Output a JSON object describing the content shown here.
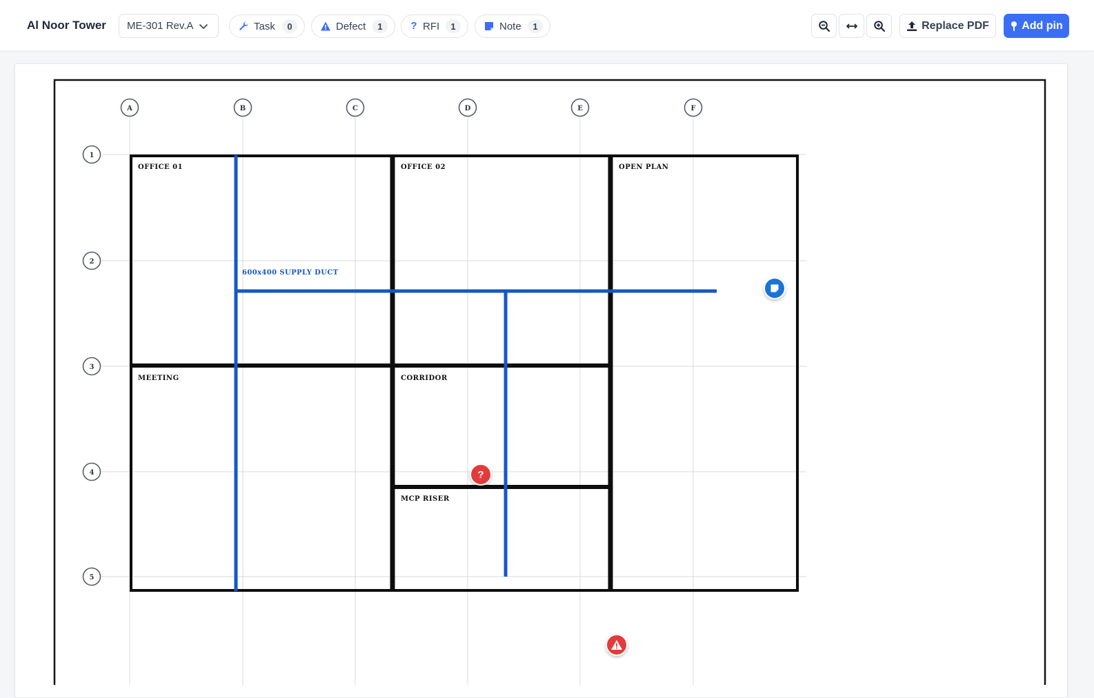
{
  "toolbar": {
    "project_title": "Al Noor Tower",
    "sheet_selected": "ME-301 Rev.A",
    "filters": [
      {
        "label": "Task",
        "count": "0",
        "icon": "wrench-icon"
      },
      {
        "label": "Defect",
        "count": "1",
        "icon": "warning-icon"
      },
      {
        "label": "RFI",
        "count": "1",
        "icon": "question-icon"
      },
      {
        "label": "Note",
        "count": "1",
        "icon": "note-icon"
      }
    ],
    "zoom_out_icon": "zoom-out-icon",
    "fit_width_icon": "fit-width-icon",
    "zoom_in_icon": "zoom-in-icon",
    "replace_label": "Replace PDF",
    "add_pin_label": "Add pin"
  },
  "drawing": {
    "grid_columns": [
      "A",
      "B",
      "C",
      "D",
      "E",
      "F"
    ],
    "grid_rows": [
      "1",
      "2",
      "3",
      "4",
      "5"
    ],
    "rooms": [
      "OFFICE 01",
      "OFFICE 02",
      "OPEN PLAN",
      "MEETING",
      "CORRIDOR",
      "MCP RISER"
    ],
    "duct_label": "600x400 SUPPLY DUCT"
  },
  "pins": {
    "rfi_symbol": "?",
    "defect_symbol": "!",
    "note_symbol": "note"
  },
  "colors": {
    "accent": "#3b6ef5",
    "duct": "#1657c7",
    "pin_red": "#e33b3b",
    "pin_blue": "#1a73d4"
  }
}
